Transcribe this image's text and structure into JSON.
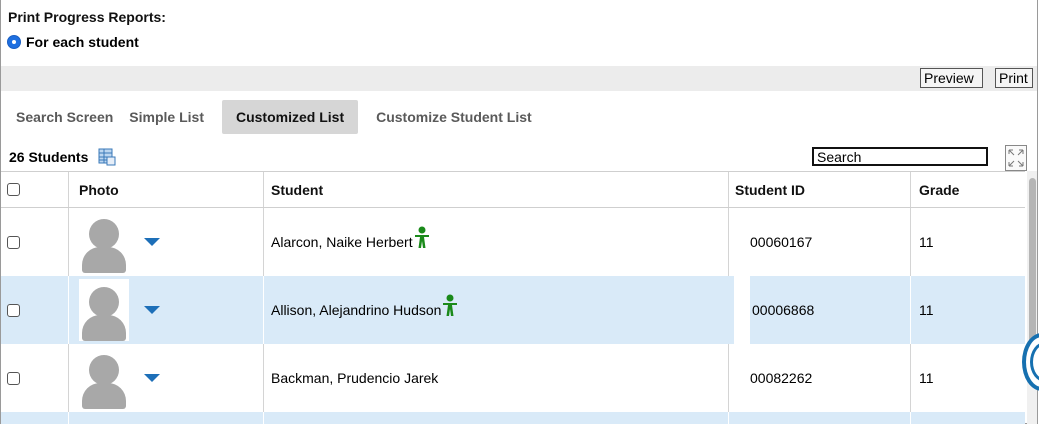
{
  "header": {
    "title": "Print Progress Reports:",
    "radio_label": "For each student"
  },
  "toolbar": {
    "preview_label": "Preview",
    "print_label": "Print"
  },
  "tabs": [
    {
      "label": "Search Screen",
      "active": false
    },
    {
      "label": "Simple List",
      "active": false
    },
    {
      "label": "Customized List",
      "active": true
    },
    {
      "label": "Customize Student List",
      "active": false
    }
  ],
  "list": {
    "count_label": "26 Students",
    "search_value": "Search"
  },
  "table": {
    "columns": [
      "Photo",
      "Student",
      "Student ID",
      "Grade"
    ],
    "rows": [
      {
        "student": "Alarcon, Naike Herbert",
        "flag_icon": "person-icon",
        "student_id": "00060167",
        "grade": "11"
      },
      {
        "student": "Allison, Alejandrino Hudson",
        "flag_icon": "person-icon",
        "student_id": "00006868",
        "grade": "11"
      },
      {
        "student": "Backman, Prudencio Jarek",
        "flag_icon": "",
        "student_id": "00082262",
        "grade": "11"
      }
    ]
  },
  "colors": {
    "accent": "#1d6fb8",
    "selected_row": "#d9eaf8",
    "active_tab": "#d6d6d6",
    "flag_green": "#1a8a1a"
  }
}
